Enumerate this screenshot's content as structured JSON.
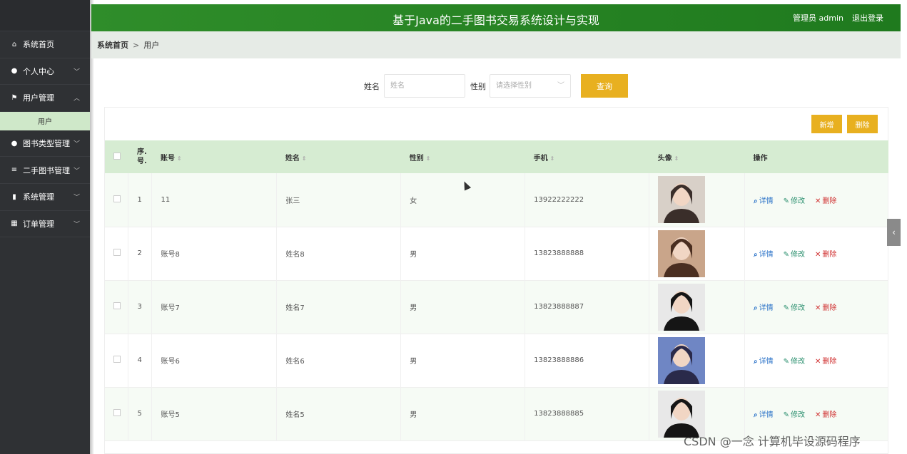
{
  "header": {
    "title": "基于Java的二手图书交易系统设计与实现",
    "user": "管理员 admin",
    "logout": "退出登录"
  },
  "sidebar": {
    "items": [
      {
        "label": "系统首页",
        "icon": "home-icon"
      },
      {
        "label": "个人中心",
        "icon": "user-icon"
      },
      {
        "label": "用户管理",
        "icon": "flag-icon"
      },
      {
        "label": "图书类型管理",
        "icon": "user-icon"
      },
      {
        "label": "二手图书管理",
        "icon": "sliders-icon"
      },
      {
        "label": "系统管理",
        "icon": "chart-icon"
      },
      {
        "label": "订单管理",
        "icon": "grid-icon"
      }
    ],
    "sub_item": "用户"
  },
  "breadcrumb": {
    "home": "系统首页",
    "sep": ">",
    "current": "用户"
  },
  "search": {
    "name_label": "姓名",
    "name_placeholder": "姓名",
    "gender_label": "性别",
    "gender_placeholder": "请选择性别",
    "query_button": "查询"
  },
  "toolbar": {
    "add": "新增",
    "delete": "删除"
  },
  "table": {
    "headers": [
      "序.\n号.",
      "账号",
      "姓名",
      "性别",
      "手机",
      "头像",
      "操作"
    ],
    "rows": [
      {
        "no": "1",
        "account": "11",
        "name": "张三",
        "gender": "女",
        "phone": "13922222222"
      },
      {
        "no": "2",
        "account": "账号8",
        "name": "姓名8",
        "gender": "男",
        "phone": "13823888888"
      },
      {
        "no": "3",
        "account": "账号7",
        "name": "姓名7",
        "gender": "男",
        "phone": "13823888887"
      },
      {
        "no": "4",
        "account": "账号6",
        "name": "姓名6",
        "gender": "男",
        "phone": "13823888886"
      },
      {
        "no": "5",
        "account": "账号5",
        "name": "姓名5",
        "gender": "男",
        "phone": "13823888885"
      }
    ],
    "ops": {
      "detail": "详情",
      "edit": "修改",
      "delete": "删除"
    }
  },
  "watermark": "CSDN @一念 计算机毕设源码程序",
  "colors": {
    "header": "#2f8d2a",
    "accent_button": "#e8b020",
    "table_header": "#d6ecd2",
    "sidebar": "#2f3134"
  }
}
